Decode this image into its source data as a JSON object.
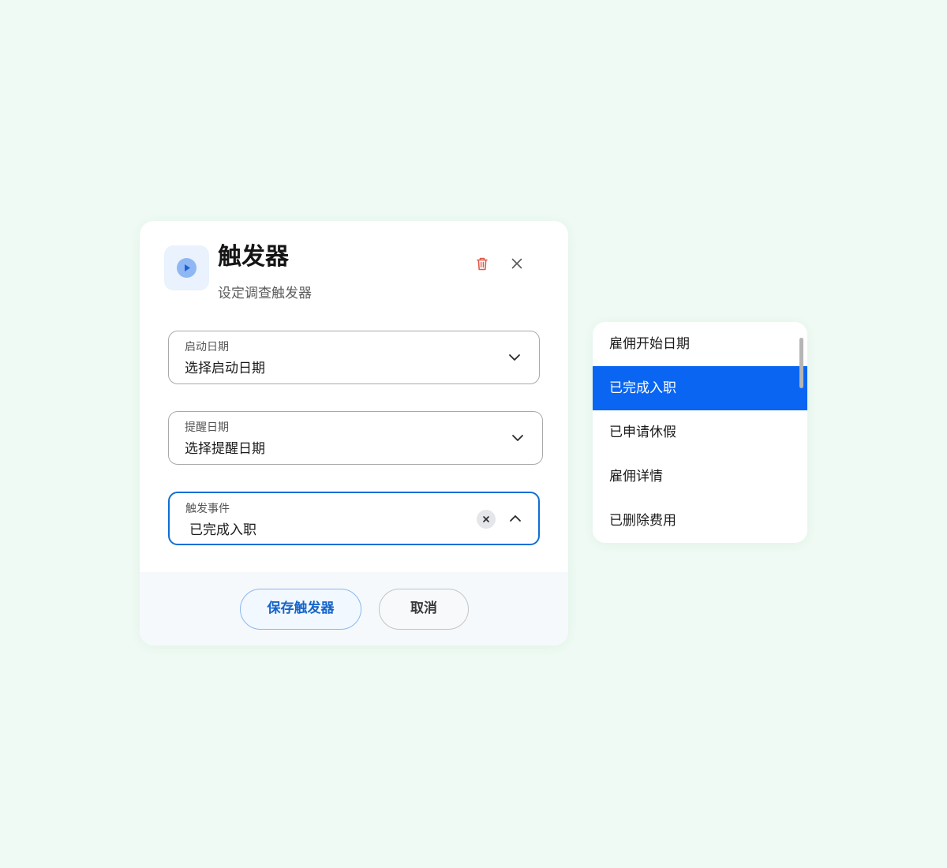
{
  "dialog": {
    "title": "触发器",
    "subtitle": "设定调查触发器",
    "header_icon": "play-icon",
    "actions": {
      "delete_icon": "trash-icon",
      "close_icon": "close-icon"
    }
  },
  "fields": {
    "start_date": {
      "label": "启动日期",
      "value": "选择启动日期",
      "icon": "chevron-down-icon"
    },
    "reminder_date": {
      "label": "提醒日期",
      "value": "选择提醒日期",
      "icon": "chevron-down-icon"
    },
    "trigger_event": {
      "label": "触发事件",
      "value": "已完成入职",
      "clear_icon": "clear-icon",
      "icon": "chevron-up-icon"
    }
  },
  "footer": {
    "save_label": "保存触发器",
    "cancel_label": "取消"
  },
  "dropdown": {
    "options": [
      {
        "label": "雇佣开始日期",
        "selected": false
      },
      {
        "label": "已完成入职",
        "selected": true
      },
      {
        "label": "已申请休假",
        "selected": false
      },
      {
        "label": "雇佣详情",
        "selected": false
      },
      {
        "label": "已删除费用",
        "selected": false
      }
    ]
  },
  "colors": {
    "page_background": "#eefaf3",
    "accent": "#0a66f2",
    "focus_border": "#0f6ed6",
    "delete": "#e05a4a"
  }
}
